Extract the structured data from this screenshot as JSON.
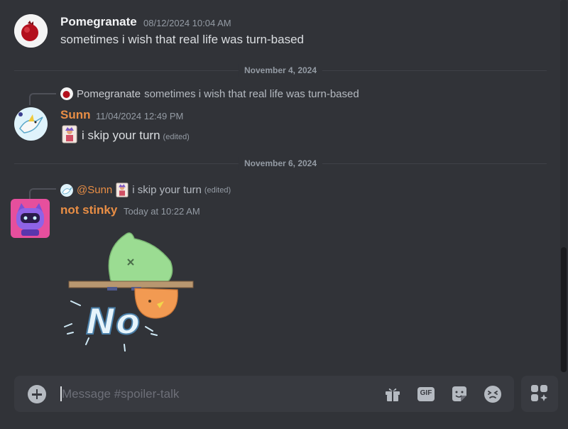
{
  "messages": [
    {
      "author": "Pomegranate",
      "timestamp": "08/12/2024 10:04 AM",
      "text": "sometimes i wish that real life was turn-based"
    },
    {
      "reply": {
        "author": "Pomegranate",
        "text": "sometimes i wish that real life was turn-based"
      },
      "author": "Sunn",
      "timestamp": "11/04/2024 12:49 PM",
      "text": "i skip your turn",
      "edited": "(edited)"
    },
    {
      "reply": {
        "author": "@Sunn",
        "text": "i skip your turn",
        "edited": "(edited)"
      },
      "author": "not stinky",
      "timestamp": "Today at 10:22 AM",
      "sticker_text": "No"
    }
  ],
  "dividers": [
    "November 4, 2024",
    "November 6, 2024"
  ],
  "composer": {
    "placeholder": "Message #spoiler-talk",
    "tools": [
      "gift-icon",
      "gif-icon",
      "sticker-icon",
      "emoji-icon"
    ],
    "gif_label": "GIF"
  },
  "colors": {
    "background": "#313338",
    "composer": "#383a40",
    "name_orange": "#e98e45",
    "muted": "#949ba4"
  }
}
